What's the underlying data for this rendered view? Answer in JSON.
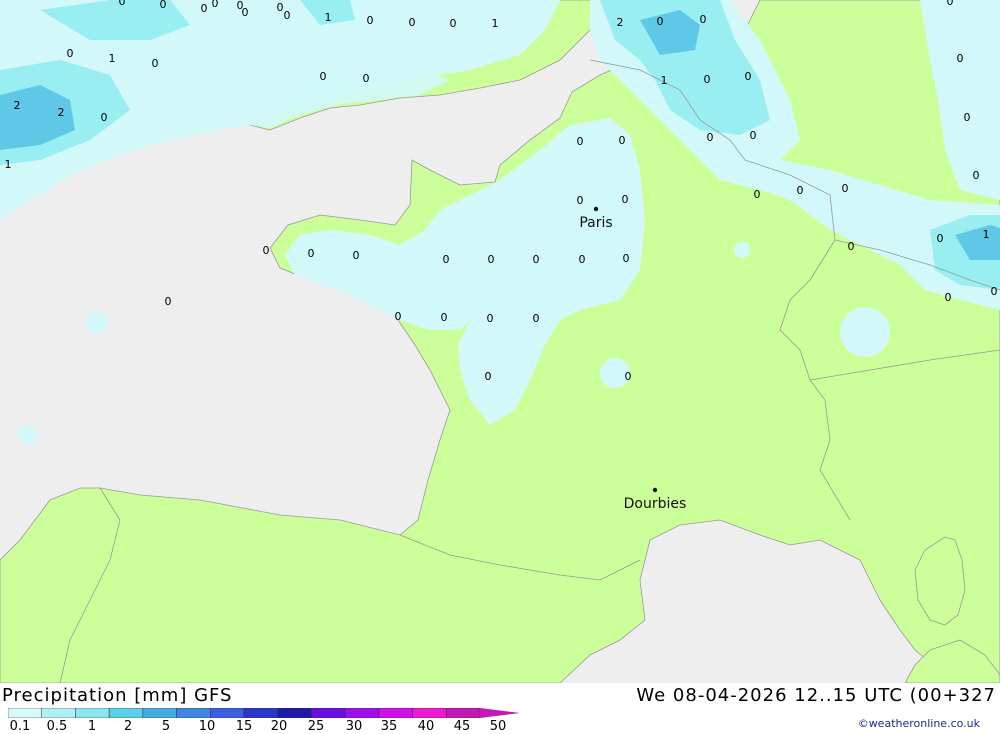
{
  "title": "Precipitation [mm] GFS",
  "datetime": "We 08-04-2026 12..15 UTC (00+327",
  "credit": "©weatheronline.co.uk",
  "colors": {
    "sea": "#eeeeee",
    "land": "#ccff99",
    "precip_light": "#d2f8fa",
    "precip_1": "#99eef2",
    "precip_2": "#5fc8e6",
    "border": "#999999"
  },
  "legend": {
    "ticks": [
      "0.1",
      "0.5",
      "1",
      "2",
      "5",
      "10",
      "15",
      "20",
      "25",
      "30",
      "35",
      "40",
      "45",
      "50"
    ],
    "colors": [
      "#d6fafc",
      "#aef1f5",
      "#8ae6ef",
      "#5bd0e8",
      "#43acdf",
      "#3f86e3",
      "#3a5fe0",
      "#2a36c8",
      "#1d1aa6",
      "#6a0fdc",
      "#9c10e6",
      "#d010e6",
      "#e81ad2",
      "#c418b4"
    ]
  },
  "cities": [
    {
      "name": "Paris"
    },
    {
      "name": "Dourbies"
    }
  ],
  "values": [
    "0",
    "0",
    "0",
    "0",
    "1",
    "0",
    "0",
    "0",
    "0",
    "1",
    "2",
    "0",
    "0",
    "1",
    "0",
    "2",
    "2",
    "0",
    "1",
    "0",
    "0",
    "0",
    "1",
    "0",
    "0",
    "0",
    "0",
    "0",
    "0",
    "0",
    "0",
    "0",
    "0",
    "0",
    "0",
    "0",
    "0",
    "0",
    "0",
    "0",
    "0",
    "0",
    "0",
    "0",
    "0",
    "0",
    "0",
    "0",
    "0",
    "0",
    "0",
    "0",
    "0",
    "0",
    "1",
    "0",
    "0",
    "0",
    "0",
    "0",
    "0"
  ]
}
